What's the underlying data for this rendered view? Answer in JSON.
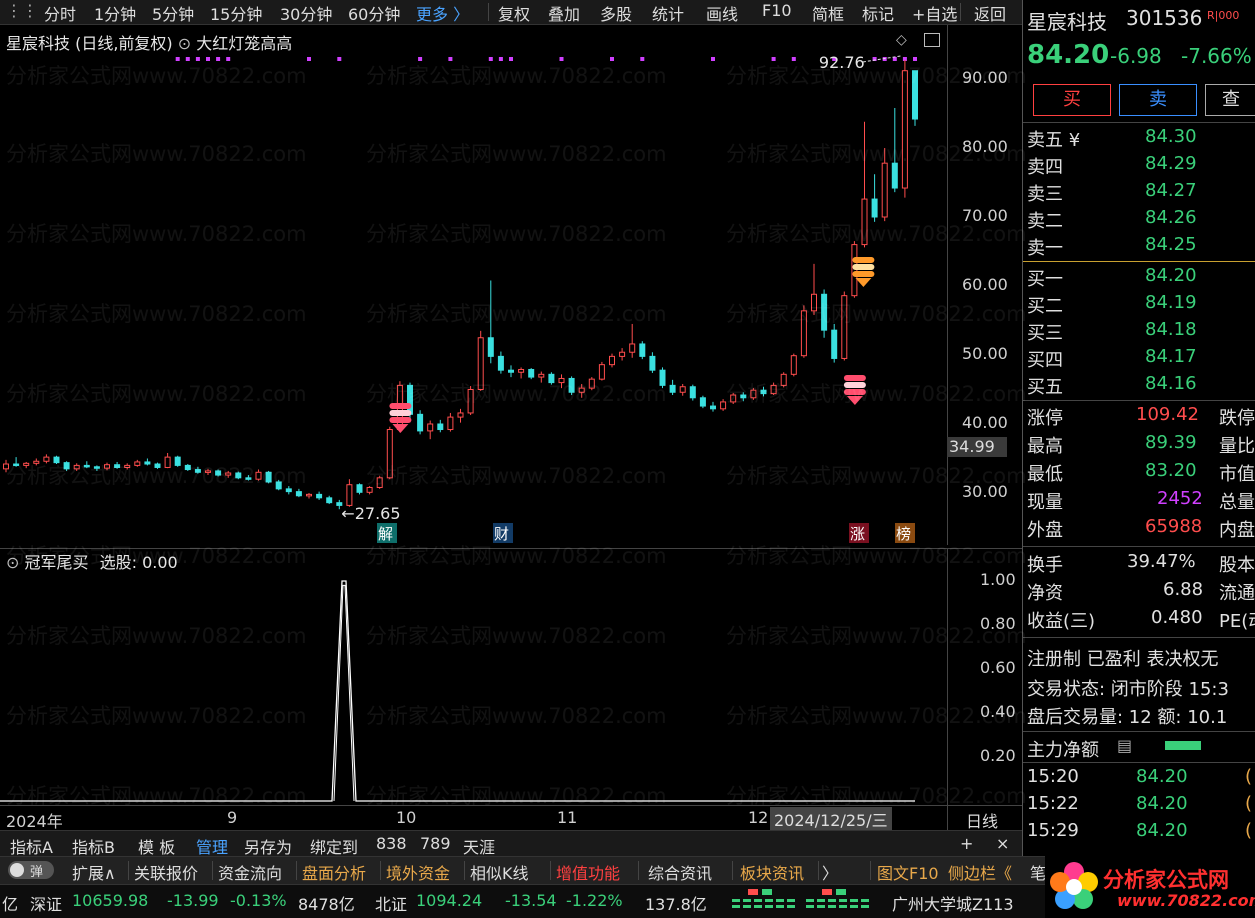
{
  "toolbar": {
    "items": [
      "分时",
      "1分钟",
      "5分钟",
      "15分钟",
      "30分钟",
      "60分钟",
      "更多 〉",
      "复权",
      "叠加",
      "多股",
      "统计",
      "画线",
      "F10",
      "简框",
      "标记",
      "+自选",
      "返回"
    ]
  },
  "main_chart": {
    "stock_title": "星宸科技 (日线,前复权)",
    "indicator_name": "大红灯笼高高",
    "max_label": "92.76",
    "min_label": "27.65",
    "current_badge": "34.99",
    "y_ticks": [
      "90.00",
      "80.00",
      "70.00",
      "60.00",
      "50.00",
      "40.00",
      "30.00"
    ],
    "event_markers": [
      "解",
      "财",
      "涨",
      "榜"
    ],
    "signal_dot_color": "#d040ff"
  },
  "sub_chart": {
    "indicator_name": "冠军尾买",
    "select_label": "选股: 0.00",
    "y_ticks": [
      "1.00",
      "0.80",
      "0.60",
      "0.40",
      "0.20"
    ]
  },
  "date_axis": {
    "labels": [
      "2024年",
      "9",
      "10",
      "11",
      "12"
    ],
    "highlight": "2024/12/25/三",
    "period": "日线"
  },
  "index_bar": {
    "items": [
      "指标A",
      "指标B",
      "模 板",
      "管理",
      "另存为",
      "绑定到",
      "838",
      "789",
      "天涯"
    ],
    "active": "管理",
    "plus": "+",
    "close": "×"
  },
  "func_bar": {
    "toggle": "弹",
    "items": [
      "扩展∧",
      "关联报价",
      "资金流向",
      "盘面分析",
      "境外资金",
      "相似K线",
      "增值功能",
      "综合资讯",
      "板块资讯",
      "〉",
      "图文F10",
      "侧边栏《",
      "笔"
    ]
  },
  "status_bar": {
    "prefix": "亿",
    "sz_name": "深证",
    "sz_value": "10659.98",
    "sz_change": "-13.99",
    "sz_pct": "-0.13%",
    "sz_amount": "8478亿",
    "bz_name": "北证",
    "bz_value": "1094.24",
    "bz_change": "-13.54",
    "bz_pct": "-1.22%",
    "bz_amount": "137.8亿",
    "ticker_text": "广州大学城Z113"
  },
  "quote_panel": {
    "name": "星宸科技",
    "code": "301536",
    "tag": "R|000",
    "price": "84.20",
    "change": "-6.98",
    "change_pct": "-7.66%",
    "buy_btn": "买",
    "sell_btn": "卖",
    "third_btn": "查",
    "sell_levels": [
      {
        "label": "卖五 ¥",
        "price": "84.30"
      },
      {
        "label": "卖四",
        "price": "84.29"
      },
      {
        "label": "卖三",
        "price": "84.27"
      },
      {
        "label": "卖二",
        "price": "84.26"
      },
      {
        "label": "卖一",
        "price": "84.25"
      }
    ],
    "buy_levels": [
      {
        "label": "买一",
        "price": "84.20"
      },
      {
        "label": "买二",
        "price": "84.19"
      },
      {
        "label": "买三",
        "price": "84.18"
      },
      {
        "label": "买四",
        "price": "84.17"
      },
      {
        "label": "买五",
        "price": "84.16"
      }
    ],
    "stats": [
      {
        "label": "涨停",
        "value": "109.42",
        "color": "r",
        "right": "跌停"
      },
      {
        "label": "最高",
        "value": "89.39",
        "color": "g",
        "right": "量比"
      },
      {
        "label": "最低",
        "value": "83.20",
        "color": "g",
        "right": "市值"
      },
      {
        "label": "现量",
        "value": "2452",
        "color": "m",
        "right": "总量"
      },
      {
        "label": "外盘",
        "value": "65988",
        "color": "r",
        "right": "内盘"
      }
    ],
    "stats2": [
      {
        "label": "换手",
        "value": "39.47%",
        "right": "股本"
      },
      {
        "label": "净资",
        "value": "6.88",
        "right": "流通"
      },
      {
        "label": "收益(三)",
        "value": "0.480",
        "right": "PE(动"
      }
    ],
    "info1": "注册制 已盈利 表决权无",
    "info2": "交易状态: 闭市阶段 15:3",
    "info3": "盘后交易量: 12  额: 10.1",
    "main_flow": "主力净额",
    "ticks": [
      {
        "time": "15:20",
        "price": "84.20",
        "vol": "("
      },
      {
        "time": "15:22",
        "price": "84.20",
        "vol": "("
      },
      {
        "time": "15:29",
        "price": "84.20",
        "vol": "("
      }
    ]
  },
  "watermark": {
    "text": "分析家公式网www.70822.com",
    "logo_title": "分析家公式网",
    "logo_url": "www.70822.com"
  },
  "chart_data": {
    "type": "candlestick",
    "title": "星宸科技 (日线,前复权)",
    "ylim": [
      24,
      95
    ],
    "y_ticks": [
      30,
      40,
      50,
      60,
      70,
      80,
      90
    ],
    "max": 92.76,
    "min": 27.65,
    "candles": [
      [
        33.5,
        34.8,
        33.0,
        34.2
      ],
      [
        34.2,
        35.2,
        33.8,
        34.0
      ],
      [
        34.0,
        34.5,
        33.6,
        34.3
      ],
      [
        34.3,
        35.0,
        34.0,
        34.6
      ],
      [
        34.6,
        35.6,
        34.3,
        35.2
      ],
      [
        35.2,
        35.4,
        34.2,
        34.4
      ],
      [
        34.4,
        34.6,
        33.2,
        33.5
      ],
      [
        33.5,
        34.3,
        33.2,
        34.0
      ],
      [
        34.0,
        34.6,
        33.6,
        33.8
      ],
      [
        33.8,
        34.0,
        33.2,
        33.6
      ],
      [
        33.6,
        34.4,
        33.3,
        34.1
      ],
      [
        34.1,
        34.5,
        33.5,
        33.7
      ],
      [
        33.7,
        34.3,
        33.4,
        34.0
      ],
      [
        34.0,
        34.8,
        33.8,
        34.5
      ],
      [
        34.5,
        35.0,
        34.0,
        34.2
      ],
      [
        34.2,
        34.4,
        33.5,
        33.7
      ],
      [
        33.7,
        35.8,
        33.6,
        35.2
      ],
      [
        35.2,
        35.4,
        33.8,
        34.0
      ],
      [
        34.0,
        34.2,
        33.2,
        33.4
      ],
      [
        33.4,
        33.8,
        32.8,
        33.0
      ],
      [
        33.0,
        33.5,
        32.6,
        33.2
      ],
      [
        33.2,
        33.4,
        32.4,
        32.6
      ],
      [
        32.6,
        33.2,
        32.2,
        32.9
      ],
      [
        32.9,
        33.1,
        32.0,
        32.2
      ],
      [
        32.2,
        32.6,
        31.8,
        32.0
      ],
      [
        32.0,
        33.4,
        31.8,
        33.0
      ],
      [
        33.0,
        33.2,
        31.4,
        31.6
      ],
      [
        31.6,
        31.9,
        30.4,
        30.6
      ],
      [
        30.6,
        31.0,
        29.8,
        30.2
      ],
      [
        30.2,
        30.6,
        29.4,
        29.6
      ],
      [
        29.6,
        30.0,
        29.2,
        29.8
      ],
      [
        29.8,
        30.2,
        29.0,
        29.3
      ],
      [
        29.3,
        29.6,
        28.4,
        28.6
      ],
      [
        28.6,
        29.0,
        27.65,
        28.2
      ],
      [
        28.2,
        32.0,
        28.0,
        31.2
      ],
      [
        31.2,
        31.4,
        29.8,
        30.1
      ],
      [
        30.1,
        31.0,
        29.8,
        30.8
      ],
      [
        30.8,
        32.5,
        30.6,
        32.2
      ],
      [
        32.2,
        39.6,
        32.0,
        39.2
      ],
      [
        39.2,
        46.2,
        38.8,
        45.6
      ],
      [
        45.6,
        46.0,
        40.8,
        41.4
      ],
      [
        41.4,
        42.0,
        38.5,
        39.0
      ],
      [
        39.0,
        40.5,
        37.8,
        40.0
      ],
      [
        40.0,
        40.6,
        38.8,
        39.2
      ],
      [
        39.2,
        41.6,
        38.9,
        41.0
      ],
      [
        41.0,
        42.2,
        40.2,
        41.6
      ],
      [
        41.6,
        45.5,
        41.3,
        45.0
      ],
      [
        45.0,
        53.5,
        44.8,
        52.5
      ],
      [
        52.5,
        60.8,
        48.8,
        49.8
      ],
      [
        49.8,
        50.5,
        47.3,
        47.8
      ],
      [
        47.8,
        48.5,
        46.8,
        47.5
      ],
      [
        47.5,
        48.2,
        46.6,
        47.9
      ],
      [
        47.9,
        48.1,
        46.5,
        46.8
      ],
      [
        46.8,
        47.6,
        46.0,
        47.2
      ],
      [
        47.2,
        47.5,
        45.7,
        46.0
      ],
      [
        46.0,
        47.2,
        45.2,
        46.6
      ],
      [
        46.6,
        46.9,
        44.2,
        44.6
      ],
      [
        44.6,
        45.8,
        43.8,
        45.2
      ],
      [
        45.2,
        46.8,
        44.9,
        46.5
      ],
      [
        46.5,
        49.0,
        46.3,
        48.6
      ],
      [
        48.6,
        50.2,
        48.2,
        49.8
      ],
      [
        49.8,
        51.0,
        49.2,
        50.4
      ],
      [
        50.4,
        54.5,
        49.6,
        51.6
      ],
      [
        51.6,
        52.0,
        49.4,
        49.8
      ],
      [
        49.8,
        50.4,
        47.4,
        47.8
      ],
      [
        47.8,
        48.2,
        45.2,
        45.6
      ],
      [
        45.6,
        46.4,
        44.2,
        44.6
      ],
      [
        44.6,
        45.8,
        44.1,
        45.4
      ],
      [
        45.4,
        45.7,
        43.4,
        43.8
      ],
      [
        43.8,
        44.1,
        42.3,
        42.6
      ],
      [
        42.6,
        43.2,
        41.8,
        42.2
      ],
      [
        42.2,
        43.6,
        41.9,
        43.2
      ],
      [
        43.2,
        44.5,
        42.9,
        44.2
      ],
      [
        44.2,
        44.6,
        43.3,
        43.8
      ],
      [
        43.8,
        45.2,
        43.5,
        44.9
      ],
      [
        44.9,
        45.4,
        44.0,
        44.4
      ],
      [
        44.4,
        46.0,
        44.2,
        45.6
      ],
      [
        45.6,
        47.5,
        45.3,
        47.2
      ],
      [
        47.2,
        50.2,
        46.9,
        49.9
      ],
      [
        49.9,
        57.2,
        49.6,
        56.4
      ],
      [
        56.4,
        63.2,
        55.8,
        58.8
      ],
      [
        58.8,
        59.5,
        52.5,
        53.6
      ],
      [
        53.6,
        54.5,
        48.9,
        49.5
      ],
      [
        49.5,
        59.2,
        49.2,
        58.6
      ],
      [
        58.6,
        66.5,
        58.3,
        66.0
      ],
      [
        66.0,
        83.8,
        65.6,
        72.6
      ],
      [
        72.6,
        76.2,
        69.3,
        70.0
      ],
      [
        70.0,
        80.0,
        69.4,
        77.8
      ],
      [
        77.8,
        85.8,
        73.6,
        74.2
      ],
      [
        74.2,
        92.76,
        72.8,
        91.2
      ],
      [
        91.2,
        89.39,
        83.2,
        84.2
      ]
    ]
  }
}
